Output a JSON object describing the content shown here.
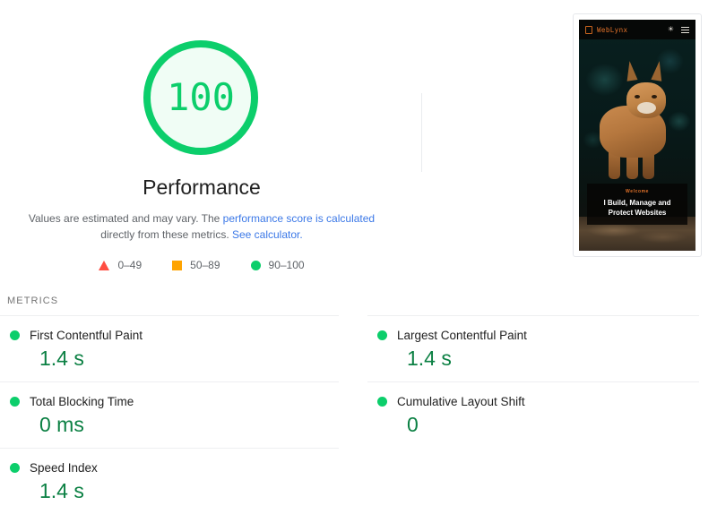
{
  "score_gauge": {
    "score": "100",
    "category_title": "Performance",
    "ring_color": "#0CCE6B",
    "fill_color": "#F0FDF5"
  },
  "disclaimer": {
    "lead": "Values are estimated and may vary. The ",
    "link_score": "performance score is calculated",
    "middle": " directly from these metrics. ",
    "link_calculator": "See calculator.",
    "link_color": "#3B78E7"
  },
  "legend": {
    "items": [
      {
        "icon": "triangle-icon",
        "label": "0–49",
        "color": "#FF4E42"
      },
      {
        "icon": "square-icon",
        "label": "50–89",
        "color": "#FFA400"
      },
      {
        "icon": "circle-icon",
        "label": "90–100",
        "color": "#0CCE6B"
      }
    ]
  },
  "screenshot_thumbnail": {
    "brand": "WebLynx",
    "logo_icon": "lynx-logo-icon",
    "theme_toggle_icon": "sun-icon",
    "menu_icon": "hamburger-menu-icon",
    "theme_toggle_glyph": "☀",
    "eyebrow": "Welcome",
    "headline": "I Build, Manage and Protect Websites",
    "accent_color": "#E2722A"
  },
  "metrics": {
    "heading": "METRICS",
    "left": [
      {
        "label": "First Contentful Paint",
        "value": "1.4 s",
        "status": "pass",
        "dot_color": "#0CCE6B"
      },
      {
        "label": "Total Blocking Time",
        "value": "0 ms",
        "status": "pass",
        "dot_color": "#0CCE6B"
      },
      {
        "label": "Speed Index",
        "value": "1.4 s",
        "status": "pass",
        "dot_color": "#0CCE6B"
      }
    ],
    "right": [
      {
        "label": "Largest Contentful Paint",
        "value": "1.4 s",
        "status": "pass",
        "dot_color": "#0CCE6B"
      },
      {
        "label": "Cumulative Layout Shift",
        "value": "0",
        "status": "pass",
        "dot_color": "#0CCE6B"
      }
    ]
  }
}
